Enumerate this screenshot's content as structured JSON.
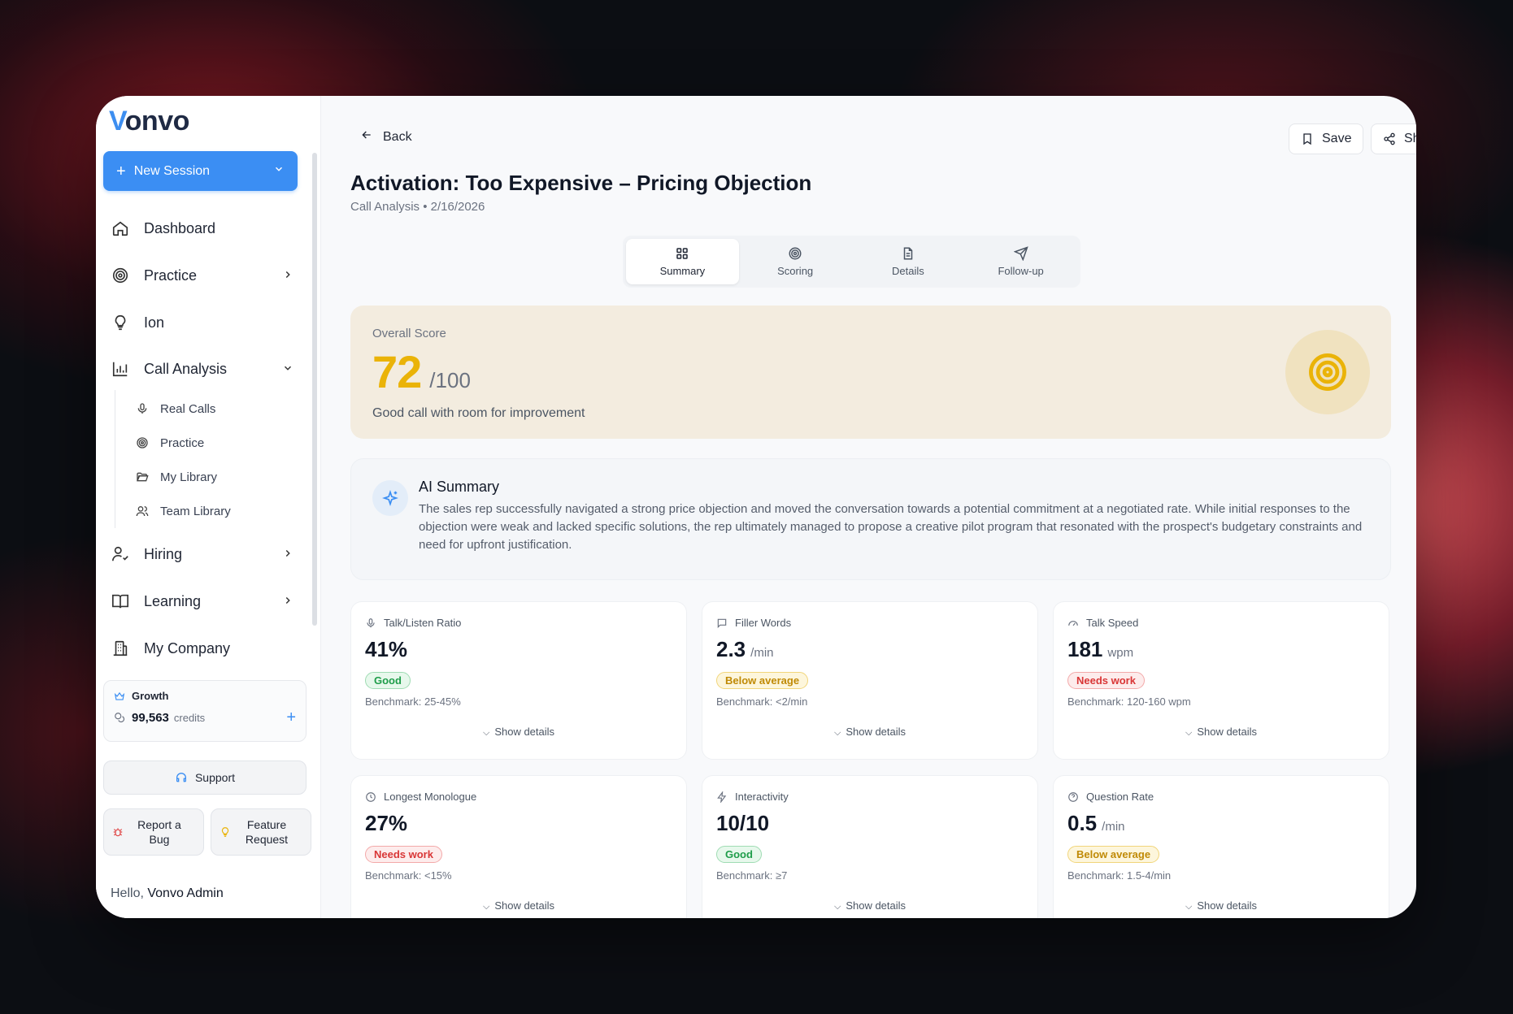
{
  "sidebar": {
    "logo_accent": "V",
    "logo_rest": "onvo",
    "new_session": "New Session",
    "nav": {
      "dashboard": "Dashboard",
      "practice": "Practice",
      "ion": "Ion",
      "call_analysis": "Call Analysis",
      "hiring": "Hiring",
      "learning": "Learning",
      "my_company": "My Company"
    },
    "call_analysis_sub": {
      "real_calls": "Real Calls",
      "practice": "Practice",
      "my_library": "My Library",
      "team_library": "Team Library"
    },
    "plan": "Growth",
    "credits_value": "99,563",
    "credits_unit": "credits",
    "support": "Support",
    "report_bug_1": "Report a",
    "report_bug_2": "Bug",
    "feature_request_1": "Feature",
    "feature_request_2": "Request",
    "hello": "Hello,",
    "user": "Vonvo Admin"
  },
  "header": {
    "back": "Back",
    "save": "Save",
    "share": "Share",
    "title": "Activation: Too Expensive – Pricing Objection",
    "subtitle": "Call Analysis • 2/16/2026"
  },
  "tabs": {
    "summary": "Summary",
    "scoring": "Scoring",
    "details": "Details",
    "followup": "Follow-up"
  },
  "score": {
    "label": "Overall Score",
    "value": "72",
    "max": "/100",
    "description": "Good call with room for improvement"
  },
  "ai_summary": {
    "title": "AI Summary",
    "text": "The sales rep successfully navigated a strong price objection and moved the conversation towards a potential commitment at a negotiated rate. While initial responses to the objection were weak and lacked specific solutions, the rep ultimately managed to propose a creative pilot program that resonated with the prospect's budgetary constraints and need for upfront justification."
  },
  "show_details": "Show details",
  "metrics": {
    "talk_listen": {
      "label": "Talk/Listen Ratio",
      "value": "41%",
      "unit": "",
      "badge": "Good",
      "benchmark": "Benchmark: 25-45%"
    },
    "filler": {
      "label": "Filler Words",
      "value": "2.3",
      "unit": "/min",
      "badge": "Below average",
      "benchmark": "Benchmark: <2/min"
    },
    "talk_speed": {
      "label": "Talk Speed",
      "value": "181",
      "unit": "wpm",
      "badge": "Needs work",
      "benchmark": "Benchmark: 120-160 wpm"
    },
    "monologue": {
      "label": "Longest Monologue",
      "value": "27%",
      "unit": "",
      "badge": "Needs work",
      "benchmark": "Benchmark: <15%"
    },
    "interactivity": {
      "label": "Interactivity",
      "value": "10/10",
      "unit": "",
      "badge": "Good",
      "benchmark": "Benchmark: ≥7"
    },
    "question_rate": {
      "label": "Question Rate",
      "value": "0.5",
      "unit": "/min",
      "badge": "Below average",
      "benchmark": "Benchmark: 1.5-4/min"
    }
  },
  "colors": {
    "accent": "#3b8ef3",
    "score": "#eab308",
    "good": "#1f9d4a",
    "below_average": "#c08a06",
    "needs_work": "#d93636"
  }
}
